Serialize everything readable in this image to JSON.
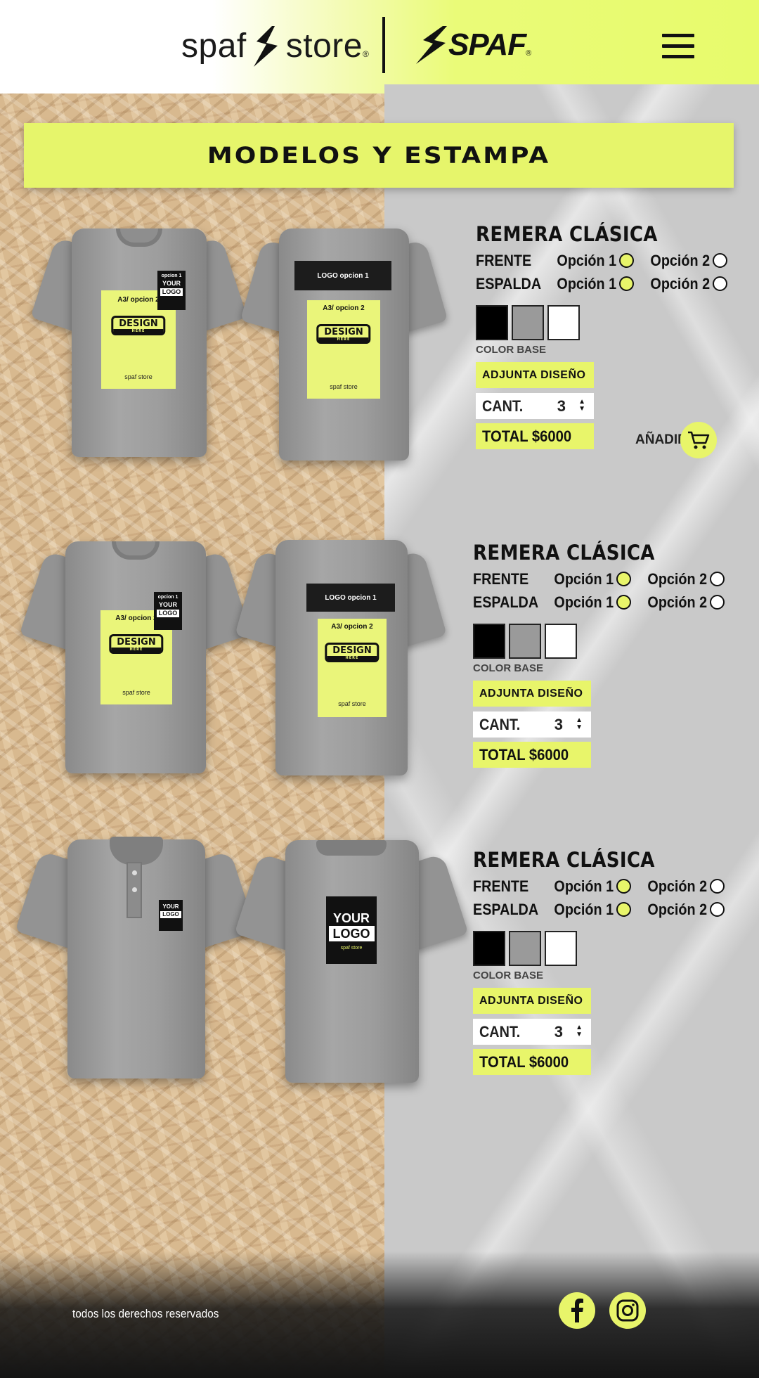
{
  "header": {
    "store_logo": {
      "left": "spaf",
      "right": "store"
    },
    "brand_logo": "SPAF",
    "registered": "®"
  },
  "banner": {
    "title": "MODELOS Y ESTAMPA"
  },
  "mockups": {
    "option1": "opcion 1",
    "option2": "A3/ opcion 2",
    "logo_option1": "LOGO  opcion 1",
    "your": "YOUR",
    "logo": "LOGO",
    "design": "DESIGN",
    "here": "HERE",
    "brand_small": "spaf store"
  },
  "products": [
    {
      "name": "REMERA CLÁSICA",
      "front_label": "FRENTE",
      "back_label": "ESPALDA",
      "option1": "Opción 1",
      "option2": "Opción 2",
      "front_selected": "Opción 1",
      "back_selected": "Opción 1",
      "colors": [
        "#000000",
        "#9a9a9a",
        "#ffffff"
      ],
      "color_label": "COLOR BASE",
      "attach_label": "ADJUNTA  DISEÑO",
      "qty_label": "CANT.",
      "qty_value": "3",
      "total_label": "TOTAL $6000",
      "add_label": "AÑADIR"
    },
    {
      "name": "REMERA CLÁSICA",
      "front_label": "FRENTE",
      "back_label": "ESPALDA",
      "option1": "Opción 1",
      "option2": "Opción 2",
      "front_selected": "Opción 1",
      "back_selected": "Opción 1",
      "colors": [
        "#000000",
        "#9a9a9a",
        "#ffffff"
      ],
      "color_label": "COLOR BASE",
      "attach_label": "ADJUNTA  DISEÑO",
      "qty_label": "CANT.",
      "qty_value": "3",
      "total_label": "TOTAL $6000"
    },
    {
      "name": "REMERA CLÁSICA",
      "front_label": "FRENTE",
      "back_label": "ESPALDA",
      "option1": "Opción 1",
      "option2": "Opción 2",
      "front_selected": "Opción 1",
      "back_selected": "Opción 1",
      "colors": [
        "#000000",
        "#9a9a9a",
        "#ffffff"
      ],
      "color_label": "COLOR BASE",
      "attach_label": "ADJUNTA  DISEÑO",
      "qty_label": "CANT.",
      "qty_value": "3",
      "total_label": "TOTAL $6000"
    }
  ],
  "footer": {
    "copyright": "todos los derechos  reservados",
    "social": [
      "facebook-icon",
      "instagram-icon"
    ]
  },
  "theme": {
    "accent": "#e8f56a",
    "dark": "#111111"
  }
}
